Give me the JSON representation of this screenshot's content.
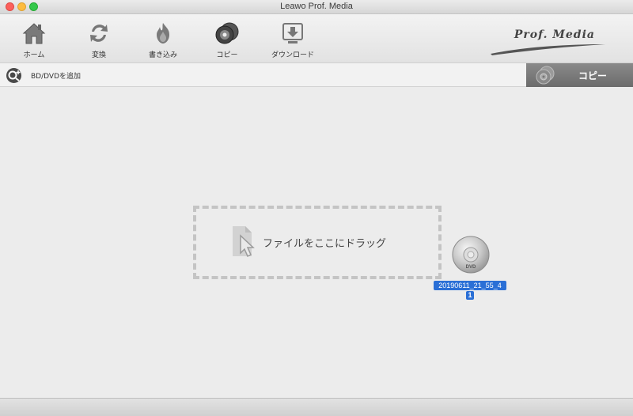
{
  "window": {
    "title": "Leawo Prof. Media"
  },
  "toolbar": {
    "items": [
      {
        "label": "ホーム",
        "icon": "home-icon"
      },
      {
        "label": "変換",
        "icon": "convert-icon"
      },
      {
        "label": "書き込み",
        "icon": "burn-icon"
      },
      {
        "label": "コピー",
        "icon": "copy-disc-icon"
      },
      {
        "label": "ダウンロード",
        "icon": "download-icon"
      }
    ],
    "brand": "Prof. Media"
  },
  "subbar": {
    "add_label": "BD/DVDを追加",
    "panel_label": "コピー"
  },
  "main": {
    "dropzone_label": "ファイルをここにドラッグ",
    "dragged_file": {
      "name": "20190611_21_55_4",
      "badge": "1",
      "disc_label": "DVD"
    }
  },
  "colors": {
    "selection": "#2a6fd6",
    "panel": "#7a7a7a"
  }
}
